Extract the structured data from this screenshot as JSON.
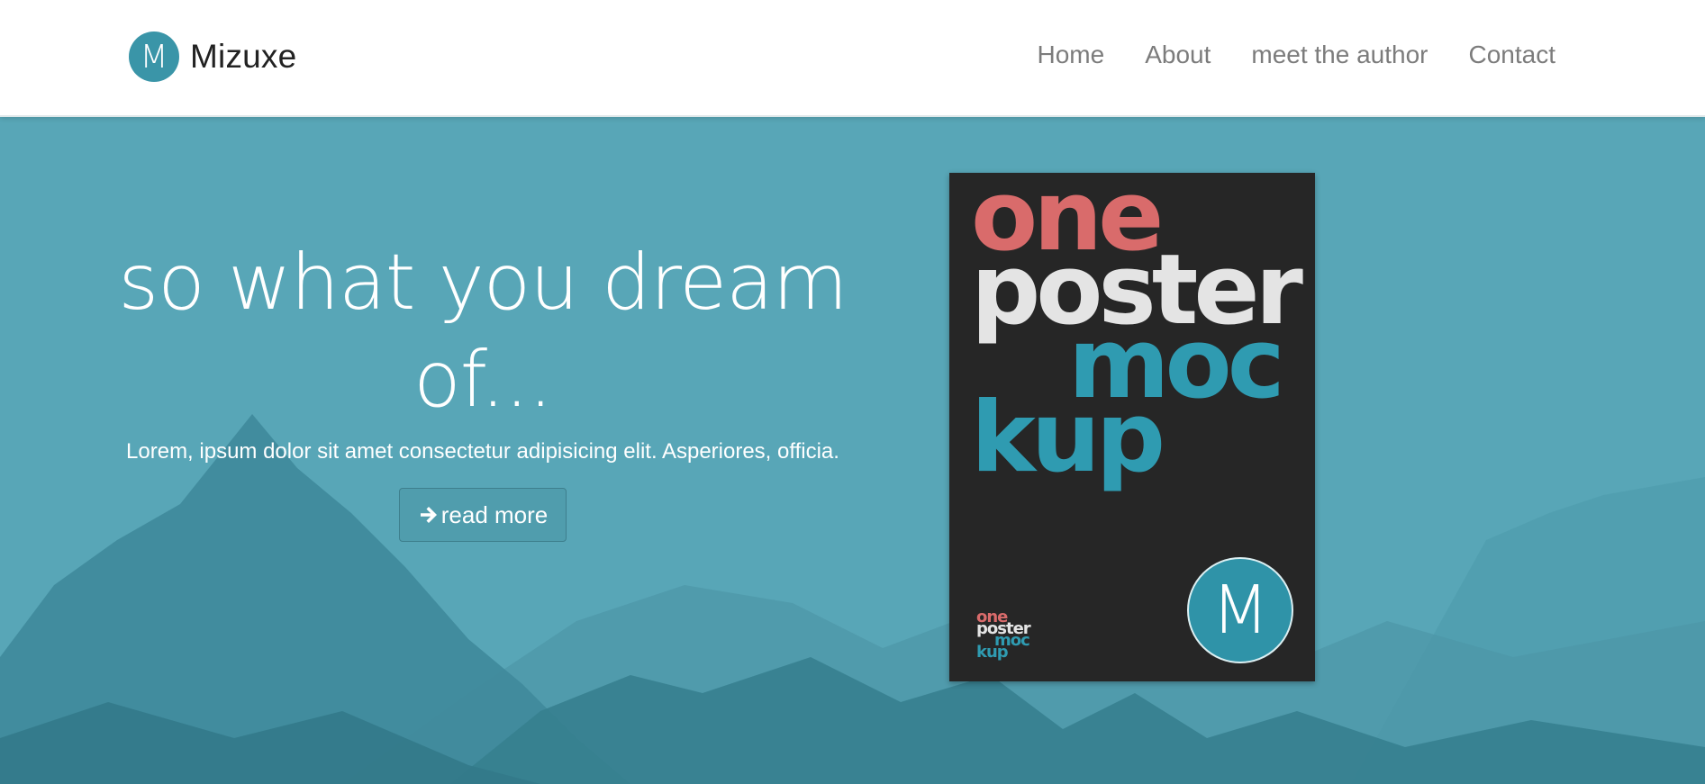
{
  "brand": {
    "logo_letter": "M",
    "name": "Mizuxe"
  },
  "nav": {
    "items": [
      {
        "label": "Home"
      },
      {
        "label": "About"
      },
      {
        "label": "meet the author"
      },
      {
        "label": "Contact"
      }
    ]
  },
  "hero": {
    "title_line1": "so what you dream",
    "title_line2": "of...",
    "subtitle": "Lorem, ipsum dolor sit amet consectetur adipisicing elit. Asperiores, officia.",
    "button_label": "read more",
    "button_icon": "arrow-right-icon"
  },
  "poster": {
    "big_text": [
      "one",
      "poster",
      "moc",
      "kup"
    ],
    "small_text": [
      "one",
      "poster",
      "moc",
      "kup"
    ],
    "badge_letter": "M",
    "colors": {
      "red": "#d96b6b",
      "white": "#e4e4e4",
      "blue": "#2f9bb1",
      "background": "#262626"
    }
  },
  "colors": {
    "accent": "#3a95a8",
    "hero_bg": "#58a6b7",
    "nav_text": "#7c7c7c"
  }
}
